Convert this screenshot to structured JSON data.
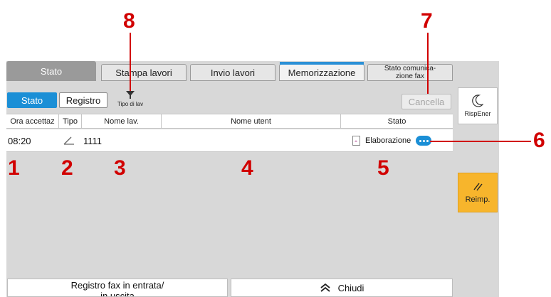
{
  "tabs": [
    {
      "label": "Stato"
    },
    {
      "label": "Stampa lavori"
    },
    {
      "label": "Invio lavori"
    },
    {
      "label": "Memorizzazione"
    },
    {
      "label": "Stato comunica-\nzione fax"
    }
  ],
  "toolbar": {
    "stato_label": "Stato",
    "registro_label": "Registro",
    "tipo_label": "Tipo di lav",
    "cancella_label": "Cancella"
  },
  "columns": [
    "Ora accettaz",
    "Tipo",
    "Nome lav.",
    "Nome utent",
    "Stato"
  ],
  "jobs": [
    {
      "time": "08:20",
      "job_name": "1111",
      "user": "",
      "status": "Elaborazione"
    }
  ],
  "side": {
    "sleep_label": "RispEner",
    "reset_label": "Reimp."
  },
  "bottom": {
    "fax_log_label": "Registro fax in entrata/\nin uscita",
    "close_label": "Chiudi"
  },
  "callouts": [
    "1",
    "2",
    "3",
    "4",
    "5",
    "6",
    "7",
    "8"
  ],
  "colors": {
    "accent": "#1b8fd6",
    "reset": "#f7b52c",
    "callout": "#d10000"
  },
  "icons": [
    "filter-arrow-icon",
    "fax-send-icon",
    "document-icon",
    "more-icon",
    "moon-icon",
    "reset-icon",
    "chevron-up-icon"
  ]
}
